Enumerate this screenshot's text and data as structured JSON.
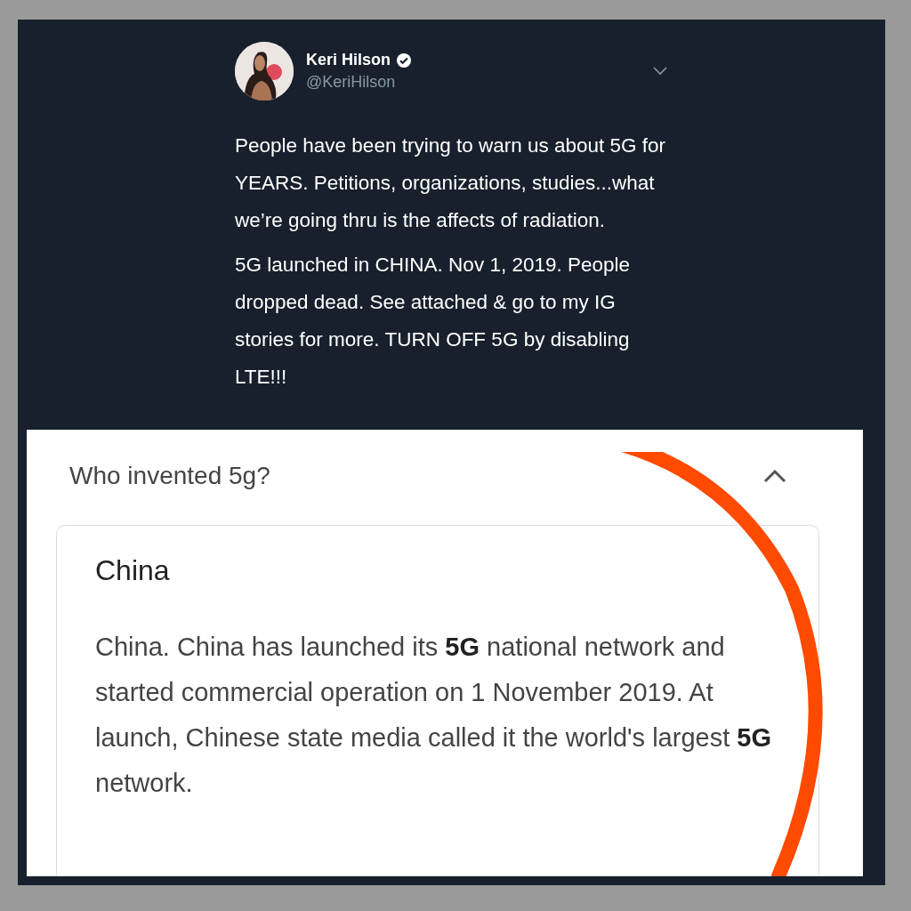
{
  "tweet": {
    "author": "Keri Hilson",
    "verified": true,
    "handle": "@KeriHilson",
    "paragraphs": [
      "People have been trying to warn us about 5G for YEARS. Petitions, organizations, studies...what we’re going thru is the affects of radiation.",
      "5G launched in CHINA. Nov 1, 2019. People dropped dead. See attached & go to my IG stories for more. TURN OFF 5G by disabling LTE!!!"
    ]
  },
  "search_result": {
    "question": "Who invented 5g?",
    "expanded": true,
    "answer_title": "China",
    "answer_text": "China. China has launched its **5G** national network and started commercial operation on 1 November 2019. At launch, Chinese state media called it the world's largest **5G** network."
  }
}
